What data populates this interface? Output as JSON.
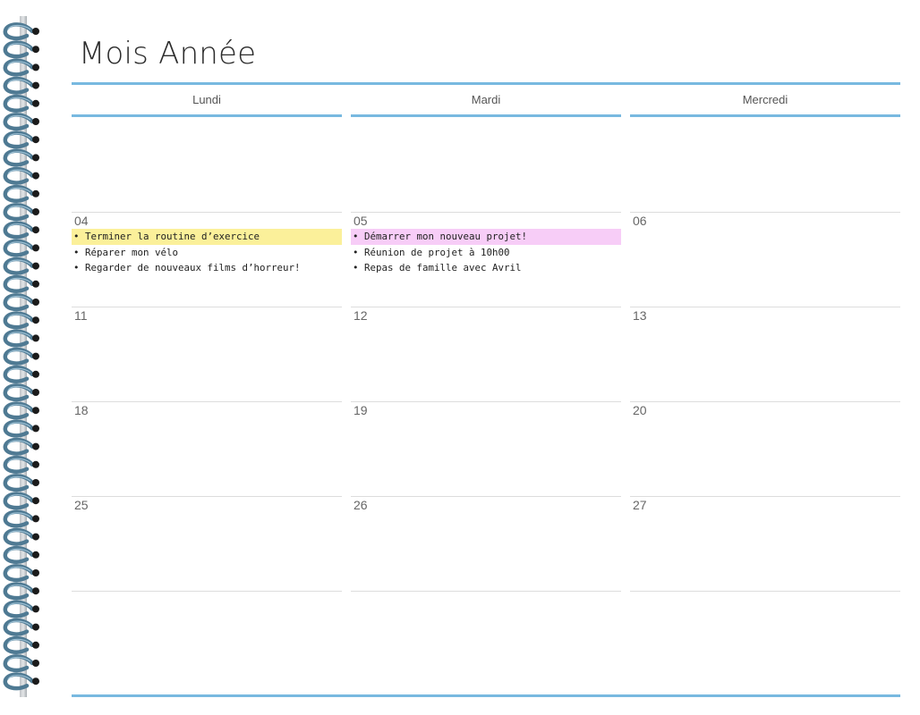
{
  "title": "Mois Année",
  "columns": [
    {
      "header": "Lundi",
      "cells": [
        {
          "day": "",
          "tasks": []
        },
        {
          "day": "04",
          "tasks": [
            {
              "text": "Terminer la routine d’exercice",
              "highlight": "#fbf09a"
            },
            {
              "text": "Réparer mon vélo"
            },
            {
              "text": "Regarder de nouveaux films d’horreur!"
            }
          ]
        },
        {
          "day": "11",
          "tasks": []
        },
        {
          "day": "18",
          "tasks": []
        },
        {
          "day": "25",
          "tasks": []
        }
      ]
    },
    {
      "header": "Mardi",
      "cells": [
        {
          "day": "",
          "tasks": []
        },
        {
          "day": "05",
          "tasks": [
            {
              "text": "Démarrer mon nouveau projet!",
              "highlight": "#f7cdf7"
            },
            {
              "text": "Réunion de projet à 10h00"
            },
            {
              "text": "Repas de famille avec Avril"
            }
          ]
        },
        {
          "day": "12",
          "tasks": []
        },
        {
          "day": "19",
          "tasks": []
        },
        {
          "day": "26",
          "tasks": []
        }
      ]
    },
    {
      "header": "Mercredi",
      "cells": [
        {
          "day": "",
          "tasks": []
        },
        {
          "day": "06",
          "tasks": []
        },
        {
          "day": "13",
          "tasks": []
        },
        {
          "day": "20",
          "tasks": []
        },
        {
          "day": "27",
          "tasks": []
        }
      ]
    }
  ],
  "colors": {
    "accent": "#78b9e0",
    "highlight_yellow": "#fbf09a",
    "highlight_pink": "#f7cdf7",
    "spiral": "#4f7a93"
  },
  "icons": {
    "binding": "spiral-binding-icon"
  }
}
